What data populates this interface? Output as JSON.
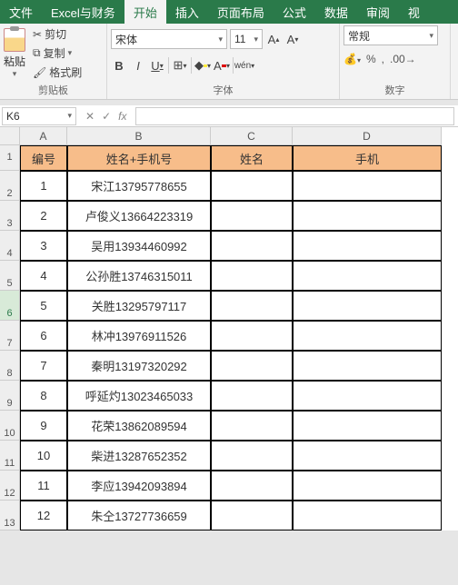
{
  "menu": {
    "file": "文件",
    "excelfin": "Excel与财务",
    "home": "开始",
    "insert": "插入",
    "layout": "页面布局",
    "formula": "公式",
    "data": "数据",
    "review": "审阅",
    "view_partial": "视"
  },
  "ribbon": {
    "clipboard": {
      "paste": "粘贴",
      "cut": "剪切",
      "copy": "复制",
      "fmtpaint": "格式刷",
      "label": "剪贴板"
    },
    "font": {
      "name": "宋体",
      "size": "11",
      "wen": "wén",
      "label": "字体"
    },
    "number": {
      "fmt": "常规",
      "label": "数字"
    }
  },
  "namebox": "K6",
  "fx": "fx",
  "cols": {
    "A": "A",
    "B": "B",
    "C": "C",
    "D": "D"
  },
  "headers": {
    "A": "编号",
    "B": "姓名+手机号",
    "C": "姓名",
    "D": "手机"
  },
  "rows": [
    {
      "n": "1",
      "a": "1",
      "b": "宋江13795778655"
    },
    {
      "n": "2",
      "a": "2",
      "b": "卢俊义13664223319"
    },
    {
      "n": "3",
      "a": "3",
      "b": "吴用13934460992"
    },
    {
      "n": "4",
      "a": "4",
      "b": "公孙胜13746315011"
    },
    {
      "n": "5",
      "a": "5",
      "b": "关胜13295797117"
    },
    {
      "n": "6",
      "a": "6",
      "b": "林冲13976911526"
    },
    {
      "n": "7",
      "a": "7",
      "b": "秦明13197320292"
    },
    {
      "n": "8",
      "a": "8",
      "b": "呼延灼13023465033"
    },
    {
      "n": "9",
      "a": "9",
      "b": "花荣13862089594"
    },
    {
      "n": "10",
      "a": "10",
      "b": "柴进13287652352"
    },
    {
      "n": "11",
      "a": "11",
      "b": "李应13942093894"
    },
    {
      "n": "12",
      "a": "12",
      "b": "朱仝13727736659"
    }
  ],
  "chart_data": {
    "type": "table",
    "title": "",
    "columns": [
      "编号",
      "姓名+手机号",
      "姓名",
      "手机"
    ],
    "rows": [
      [
        1,
        "宋江13795778655",
        "",
        ""
      ],
      [
        2,
        "卢俊义13664223319",
        "",
        ""
      ],
      [
        3,
        "吴用13934460992",
        "",
        ""
      ],
      [
        4,
        "公孙胜13746315011",
        "",
        ""
      ],
      [
        5,
        "关胜13295797117",
        "",
        ""
      ],
      [
        6,
        "林冲13976911526",
        "",
        ""
      ],
      [
        7,
        "秦明13197320292",
        "",
        ""
      ],
      [
        8,
        "呼延灼13023465033",
        "",
        ""
      ],
      [
        9,
        "花荣13862089594",
        "",
        ""
      ],
      [
        10,
        "柴进13287652352",
        "",
        ""
      ],
      [
        11,
        "李应13942093894",
        "",
        ""
      ],
      [
        12,
        "朱仝13727736659",
        "",
        ""
      ]
    ]
  }
}
